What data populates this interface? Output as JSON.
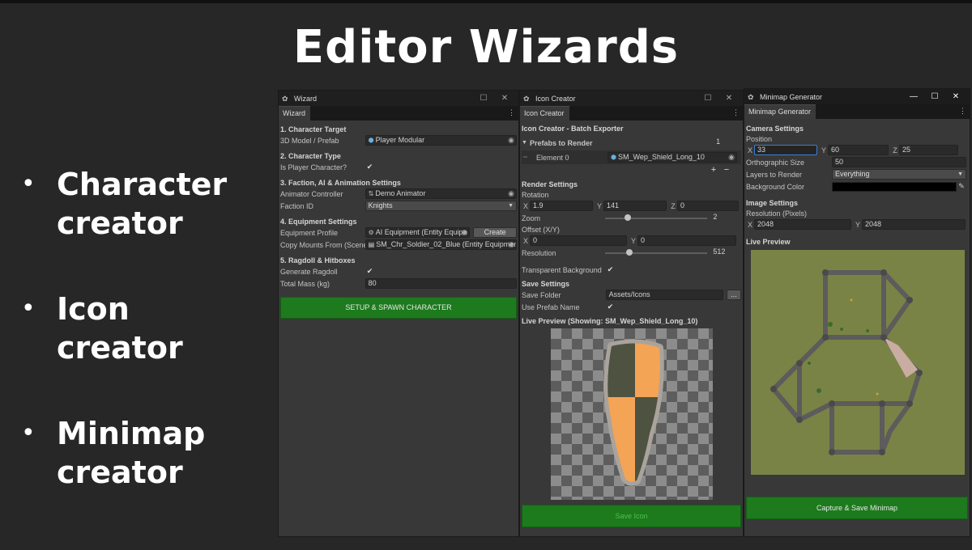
{
  "slide": {
    "title": "Editor Wizards",
    "bullets": [
      "Character creator",
      "Icon creator",
      "Minimap creator"
    ]
  },
  "wizard": {
    "window_title": "Wizard",
    "tab": "Wizard",
    "s1": "1. Character Target",
    "model_label": "3D Model / Prefab",
    "model_value": "Player Modular",
    "s2": "2. Character Type",
    "player_label": "Is Player Character?",
    "player_checked": true,
    "s3": "3. Faction, AI & Animation Settings",
    "animator_label": "Animator Controller",
    "animator_value": "Demo Animator",
    "faction_label": "Faction ID",
    "faction_value": "Knights",
    "s4": "4. Equipment Settings",
    "equip_label": "Equipment Profile",
    "equip_value": "AI Equipment (Entity Equipn",
    "create_label": "Create",
    "mounts_label": "Copy Mounts From (Scene",
    "mounts_value": "SM_Chr_Soldier_02_Blue (Entity Equipmen",
    "s5": "5. Ragdoll & Hitboxes",
    "ragdoll_label": "Generate Ragdoll",
    "ragdoll_checked": true,
    "mass_label": "Total Mass (kg)",
    "mass_value": "80",
    "setup_button": "SETUP & SPAWN CHARACTER"
  },
  "icon": {
    "window_title": "Icon Creator",
    "tab": "Icon Creator",
    "header": "Icon Creator - Batch Exporter",
    "prefabs_label": "Prefabs to Render",
    "prefabs_count": "1",
    "element_label": "Element 0",
    "element_value": "SM_Wep_Shield_Long_10",
    "render_h": "Render Settings",
    "rotation_label": "Rotation",
    "rot_x": "1.9",
    "rot_y": "141",
    "rot_z": "0",
    "zoom_label": "Zoom",
    "zoom_value": "2",
    "zoom_fraction": 0.2,
    "offset_label": "Offset (X/Y)",
    "off_x": "0",
    "off_y": "0",
    "res_label": "Resolution",
    "res_value": "512",
    "res_fraction": 0.22,
    "transparent_label": "Transparent Background",
    "save_h": "Save Settings",
    "folder_label": "Save Folder",
    "folder_value": "Assets/Icons",
    "browse_label": "...",
    "useprefab_label": "Use Prefab Name",
    "preview_label": "Live Preview (Showing: SM_Wep_Shield_Long_10)",
    "save_button": "Save Icon"
  },
  "minimap": {
    "window_title": "Minimap Generator",
    "tab": "Minimap Generator",
    "camera_h": "Camera Settings",
    "position_label": "Position",
    "pos_x": "33",
    "pos_y": "60",
    "pos_z": "25",
    "ortho_label": "Orthographic Size",
    "ortho_value": "50",
    "layers_label": "Layers to Render",
    "layers_value": "Everything",
    "bg_label": "Background Color",
    "bg_color": "#000000",
    "image_h": "Image Settings",
    "res_label": "Resolution (Pixels)",
    "res_x": "2048",
    "res_y": "2048",
    "preview_label": "Live Preview",
    "capture_button": "Capture & Save Minimap"
  },
  "axes": {
    "x": "X",
    "y": "Y",
    "z": "Z"
  },
  "colors": {
    "accent_green": "#1d7a1d",
    "editor_bg": "#383838",
    "grass": "#7d8549",
    "wall": "#5e5c5c",
    "path": "#c9aca2"
  }
}
